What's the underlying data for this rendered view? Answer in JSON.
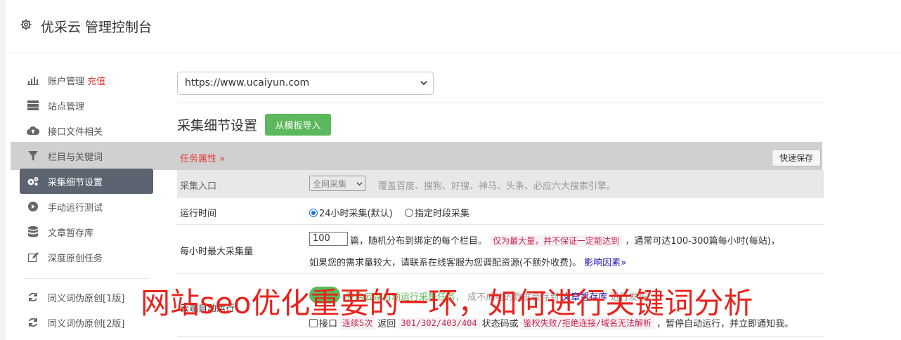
{
  "header": {
    "title": "优采云 管理控制台"
  },
  "sidebar": {
    "items": [
      {
        "label": "账户管理",
        "badge": "充值",
        "icon": "bar-chart-icon"
      },
      {
        "label": "站点管理",
        "icon": "server-icon"
      },
      {
        "label": "接口文件相关",
        "icon": "cloud-upload-icon"
      },
      {
        "label": "栏目与关键词",
        "icon": "filter-icon"
      },
      {
        "label": "采集细节设置",
        "icon": "cogs-icon",
        "active": true
      },
      {
        "label": "手动运行测试",
        "icon": "play-circle-icon"
      },
      {
        "label": "文章暂存库",
        "icon": "database-icon"
      },
      {
        "label": "深度原创任务",
        "icon": "edit-icon"
      },
      {
        "label": "同义词伪原创[1版]",
        "icon": "refresh-icon"
      },
      {
        "label": "同义词伪原创[2版]",
        "icon": "refresh-icon"
      }
    ]
  },
  "site_select": {
    "value": "https://www.ucaiyun.com"
  },
  "section": {
    "title": "采集细节设置",
    "import_label": "从模板导入"
  },
  "task": {
    "title": "任务属性 »",
    "quick_save": "快速保存"
  },
  "rows": {
    "entry": {
      "label": "采集入口",
      "select_value": "全网采集",
      "desc": "覆盖百度、搜狗、好搜、神马、头条、必应六大搜索引擎。"
    },
    "runtime": {
      "label": "运行时间",
      "opt1": "24小时采集(默认)",
      "opt2": "指定时段采集"
    },
    "max_per_hour": {
      "label": "每小时最大采集量",
      "value": "100",
      "text1": "篇，随机分布到绑定的每个栏目。",
      "code1": "仅为最大量，并不保证一定能达到",
      "text2": "，通常可达100-300篇每小时(每站)，",
      "text3": "如果您的需求量较大，请联系在线客服为您调配资源(不额外收费)。",
      "link": "影响因素»"
    },
    "auto": {
      "label": "云端自动运行",
      "green1": "开启云端自动运行采集任务，",
      "hidden": "成不成功的数据会存到",
      "link": "文章暂存库",
      "tail": "进行发布",
      "cb_label": "接口",
      "code1": "连续5次",
      "text1": "返回",
      "code2": "301/302/403/404",
      "text2": "状态码或",
      "code3": "鉴权失败/拒绝连接/域名无法解析",
      "text3": "，暂停自动运行，并立即通知我。"
    }
  },
  "overlay_text": "网站seo优化重要的一环，如何进行关键词分析"
}
